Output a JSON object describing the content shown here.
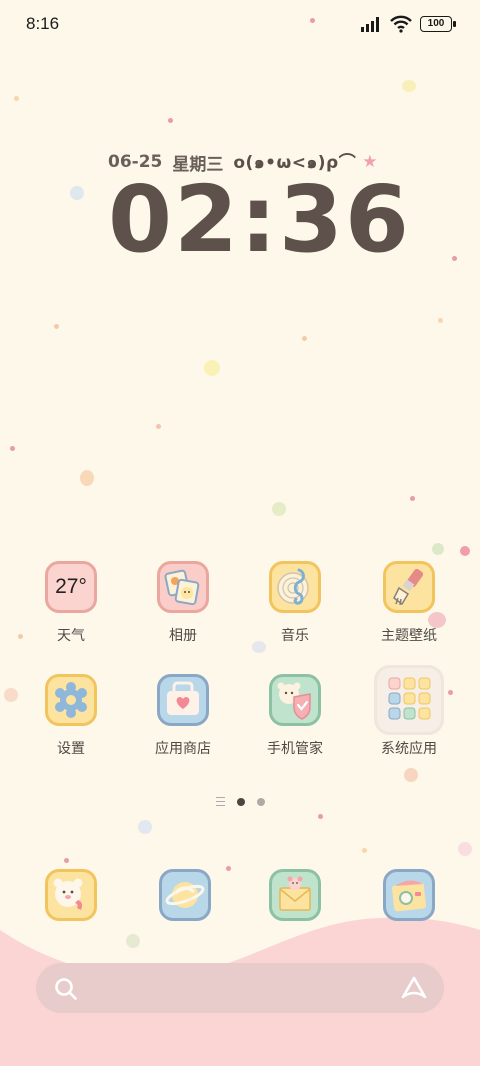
{
  "status_bar": {
    "time": "8:16",
    "battery": "100"
  },
  "lockclock": {
    "date": "06-25",
    "weekday": "星期三",
    "kaomoji": "o(๑•ω<๑)ρ⌒",
    "time": "02:36"
  },
  "apps_row1": [
    {
      "label": "天气",
      "icon": "weather-icon",
      "temp": "27°"
    },
    {
      "label": "相册",
      "icon": "album-icon"
    },
    {
      "label": "音乐",
      "icon": "music-icon"
    },
    {
      "label": "主题壁纸",
      "icon": "theme-wallpaper-icon"
    }
  ],
  "apps_row2": [
    {
      "label": "设置",
      "icon": "settings-icon"
    },
    {
      "label": "应用商店",
      "icon": "app-store-icon"
    },
    {
      "label": "手机管家",
      "icon": "phone-manager-icon"
    },
    {
      "label": "系统应用",
      "icon": "system-apps-folder-icon"
    }
  ],
  "dock": [
    {
      "icon": "phone-icon"
    },
    {
      "icon": "browser-icon"
    },
    {
      "icon": "messages-icon"
    },
    {
      "icon": "camera-icon"
    }
  ],
  "pager": {
    "pages": 2,
    "current": 1
  },
  "colors": {
    "background": "#fdf8ea",
    "wave": "#fbd5d3",
    "search_bar": "#e8cccb",
    "clock": "#5e514c"
  }
}
